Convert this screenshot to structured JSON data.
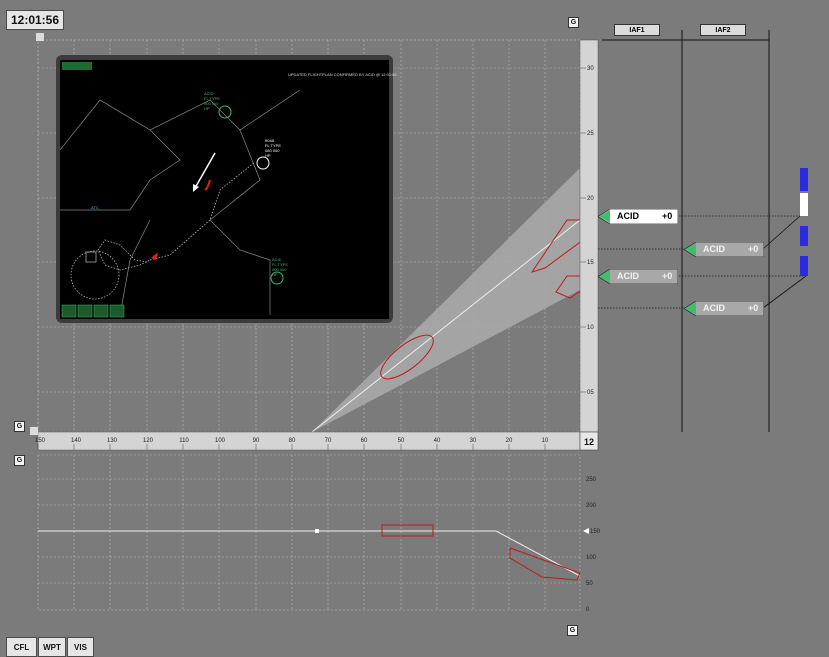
{
  "clock": "12:01:56",
  "corner_button_label": "G",
  "radar": {
    "banner": "UPDATED FLIGHTPLAN CONFIRMED BY ACID @ 12:01:56",
    "ac_top_label": [
      "ACID",
      "FL TYPE",
      "000 000",
      "HP"
    ],
    "ac_white_label": [
      "9048",
      "FL TYPE",
      "080 000",
      "HP"
    ],
    "ac_cyan_label": "ATC",
    "ac_green_label": [
      "ACID",
      "FL TYPE",
      "000 000",
      "HP"
    ]
  },
  "iaf": [
    "IAF1",
    "IAF2"
  ],
  "strips": [
    {
      "acid": "ACID",
      "delta": "+0",
      "selected": true
    },
    {
      "acid": "ACID",
      "delta": "+0",
      "selected": false
    },
    {
      "acid": "ACID",
      "delta": "+0",
      "selected": false
    },
    {
      "acid": "ACID",
      "delta": "+0",
      "selected": false
    }
  ],
  "range_scale": {
    "current": "12",
    "ticks": [
      "150",
      "140",
      "130",
      "120",
      "110",
      "100",
      "90",
      "80",
      "70",
      "60",
      "50",
      "40",
      "30",
      "20",
      "10"
    ]
  },
  "altitude_scale": {
    "ticks": [
      "30",
      "25",
      "20",
      "15",
      "10",
      "05"
    ]
  },
  "vertical_profile_scale": {
    "ticks": [
      "250",
      "200",
      "150",
      "100",
      "50",
      "0"
    ]
  },
  "buttons": {
    "cfl": "CFL",
    "wpt": "WPT",
    "vis": "VIS"
  }
}
